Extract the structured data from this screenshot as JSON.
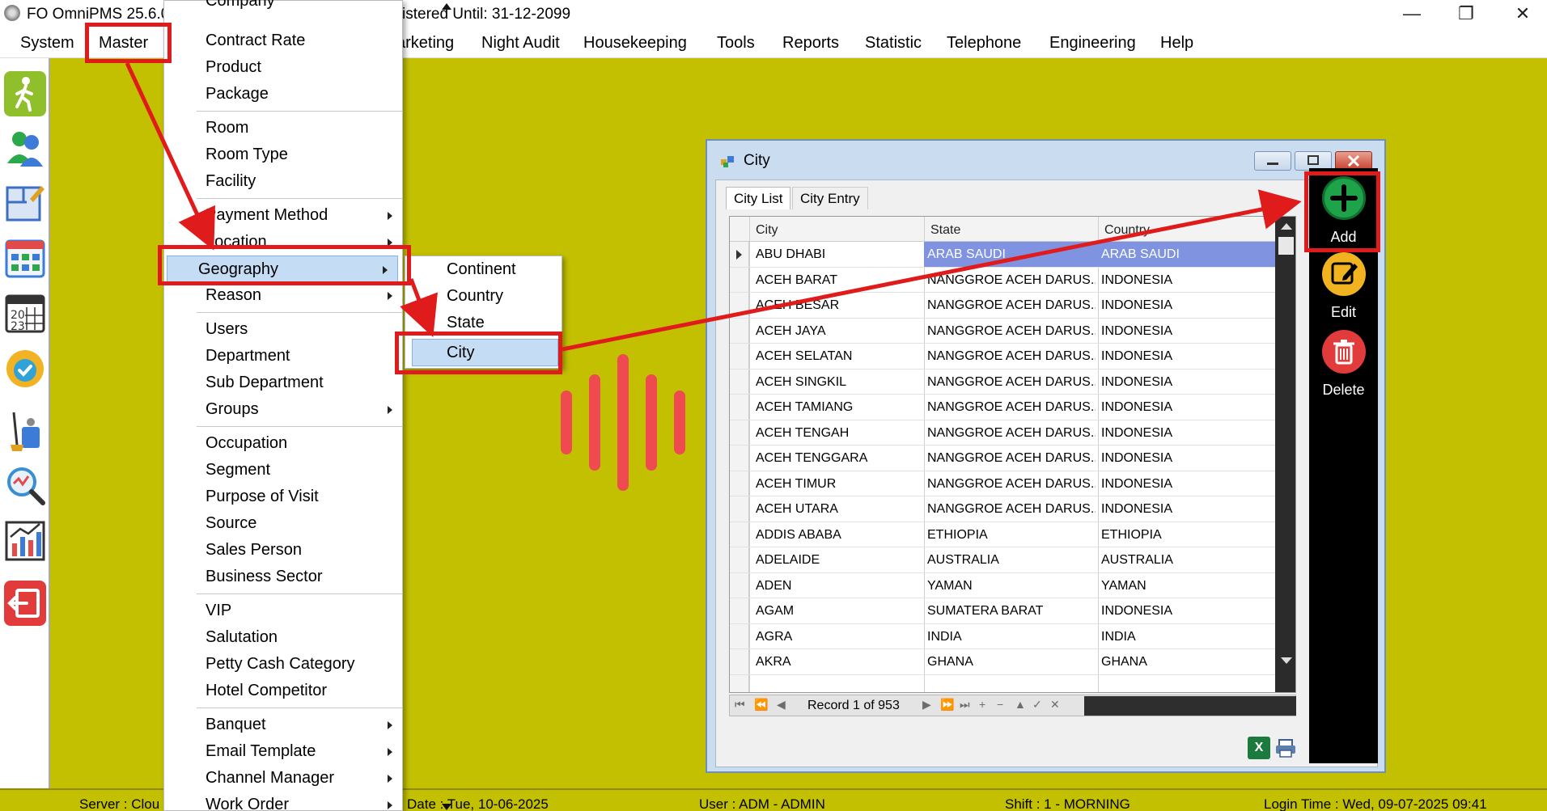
{
  "titlebar": {
    "title_left": "FO OmniPMS 25.6.0.0",
    "title_right": "istered Until: 31-12-2099",
    "minimize_glyph": "—",
    "restore_glyph": "❐",
    "close_glyph": "✕"
  },
  "menubar": {
    "items": [
      "System",
      "Master",
      "arketing",
      "Night Audit",
      "Housekeeping",
      "Tools",
      "Reports",
      "Statistic",
      "Telephone",
      "Engineering",
      "Help"
    ]
  },
  "dropdown": {
    "items": [
      {
        "label": "Company",
        "submenu": false
      },
      {
        "label": "Contract Rate",
        "submenu": false
      },
      {
        "label": "Product",
        "submenu": false
      },
      {
        "label": "Package",
        "submenu": false
      },
      {
        "label": "Room",
        "submenu": false
      },
      {
        "label": "Room Type",
        "submenu": false
      },
      {
        "label": "Facility",
        "submenu": false
      },
      {
        "label": "Payment Method",
        "submenu": true
      },
      {
        "label": "Location",
        "submenu": true
      },
      {
        "label": "Geography",
        "submenu": true
      },
      {
        "label": "Reason",
        "submenu": true
      },
      {
        "label": "Users",
        "submenu": false
      },
      {
        "label": "Department",
        "submenu": false
      },
      {
        "label": "Sub Department",
        "submenu": false
      },
      {
        "label": "Groups",
        "submenu": true
      },
      {
        "label": "Occupation",
        "submenu": false
      },
      {
        "label": "Segment",
        "submenu": false
      },
      {
        "label": "Purpose of Visit",
        "submenu": false
      },
      {
        "label": "Source",
        "submenu": false
      },
      {
        "label": "Sales Person",
        "submenu": false
      },
      {
        "label": "Business Sector",
        "submenu": false
      },
      {
        "label": "VIP",
        "submenu": false
      },
      {
        "label": "Salutation",
        "submenu": false
      },
      {
        "label": "Petty Cash Category",
        "submenu": false
      },
      {
        "label": "Hotel Competitor",
        "submenu": false
      },
      {
        "label": "Banquet",
        "submenu": true
      },
      {
        "label": "Email Template",
        "submenu": true
      },
      {
        "label": "Channel Manager",
        "submenu": true
      },
      {
        "label": "Work Order",
        "submenu": true
      }
    ]
  },
  "submenu": {
    "items": [
      "Continent",
      "Country",
      "State",
      "City"
    ]
  },
  "city_window": {
    "title": "City",
    "tabs": [
      "City List",
      "City Entry"
    ],
    "columns": [
      "City",
      "State",
      "Country"
    ],
    "rows": [
      [
        "ABU DHABI",
        "ARAB SAUDI",
        "ARAB SAUDI"
      ],
      [
        "ACEH BARAT",
        "NANGGROE ACEH DARUS...",
        "INDONESIA"
      ],
      [
        "ACEH BESAR",
        "NANGGROE ACEH DARUS...",
        "INDONESIA"
      ],
      [
        "ACEH JAYA",
        "NANGGROE ACEH DARUS...",
        "INDONESIA"
      ],
      [
        "ACEH SELATAN",
        "NANGGROE ACEH DARUS...",
        "INDONESIA"
      ],
      [
        "ACEH SINGKIL",
        "NANGGROE ACEH DARUS...",
        "INDONESIA"
      ],
      [
        "ACEH TAMIANG",
        "NANGGROE ACEH DARUS...",
        "INDONESIA"
      ],
      [
        "ACEH TENGAH",
        "NANGGROE ACEH DARUS...",
        "INDONESIA"
      ],
      [
        "ACEH TENGGARA",
        "NANGGROE ACEH DARUS...",
        "INDONESIA"
      ],
      [
        "ACEH TIMUR",
        "NANGGROE ACEH DARUS...",
        "INDONESIA"
      ],
      [
        "ACEH UTARA",
        "NANGGROE ACEH DARUS...",
        "INDONESIA"
      ],
      [
        "ADDIS ABABA",
        "ETHIOPIA",
        "ETHIOPIA"
      ],
      [
        "ADELAIDE",
        "AUSTRALIA",
        "AUSTRALIA"
      ],
      [
        "ADEN",
        "YAMAN",
        "YAMAN"
      ],
      [
        "AGAM",
        "SUMATERA BARAT",
        "INDONESIA"
      ],
      [
        "AGRA",
        "INDIA",
        "INDIA"
      ],
      [
        "AKRA",
        "GHANA",
        "GHANA"
      ]
    ],
    "record_text": "Record 1 of 953",
    "excel_label": "X",
    "actions": {
      "add": "Add",
      "edit": "Edit",
      "delete": "Delete"
    }
  },
  "statusbar": {
    "server": "Server : Clou",
    "date": "Date : Tue, 10-06-2025",
    "user": "User : ADM - ADMIN",
    "shift": "Shift : 1 - MORNING",
    "login": "Login Time : Wed, 09-07-2025 09:41"
  },
  "colors": {
    "background": "#c2c000",
    "annotation": "#e01b1b",
    "highlight": "#c4dcf4",
    "selection": "#7f93e0"
  }
}
